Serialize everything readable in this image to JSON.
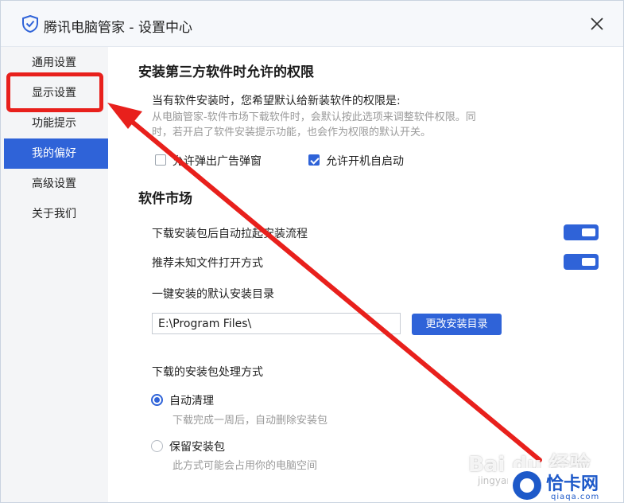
{
  "window": {
    "title": "腾讯电脑管家 - 设置中心"
  },
  "sidebar": {
    "items": [
      {
        "label": "通用设置"
      },
      {
        "label": "显示设置"
      },
      {
        "label": "功能提示"
      },
      {
        "label": "我的偏好"
      },
      {
        "label": "高级设置"
      },
      {
        "label": "关于我们"
      }
    ],
    "active_item": "我的偏好"
  },
  "permissions": {
    "heading": "安装第三方软件时允许的权限",
    "question": "当有软件安装时，您希望默认给新装软件的权限是:",
    "desc_line1": "从电脑管家-软件市场下载软件时，会默认按此选项来调整软件权限。同",
    "desc_line2": "时，若开启了软件安装提示功能，也会作为权限的默认开关。",
    "options": [
      {
        "label": "允许弹出广告弹窗",
        "checked": false
      },
      {
        "label": "允许开机自启动",
        "checked": true
      }
    ]
  },
  "market": {
    "heading": "软件市场",
    "settings": [
      {
        "label": "下载安装包后自动拉起安装流程",
        "enabled": true
      },
      {
        "label": "推荐未知文件打开方式",
        "enabled": true
      }
    ],
    "install_dir_label": "一键安装的默认安装目录",
    "install_dir_value": "E:\\Program Files\\",
    "change_dir_button": "更改安装目录",
    "package_handling_label": "下载的安装包处理方式",
    "package_options": [
      {
        "label": "自动清理",
        "desc": "下载完成一周后，自动删除安装包",
        "selected": true
      },
      {
        "label": "保留安装包",
        "desc": "此方式可能会占用你的电脑空间",
        "selected": false
      }
    ]
  },
  "watermark": {
    "text": "Bai du 经验",
    "sub": "jingyan.baidu.com"
  },
  "site_logo": {
    "name": "恰卡网",
    "url": "qiaqa.com"
  },
  "colors": {
    "accent": "#2f63d8",
    "annotation": "#e8201c",
    "sidebar_bg": "#f4f5f7"
  }
}
